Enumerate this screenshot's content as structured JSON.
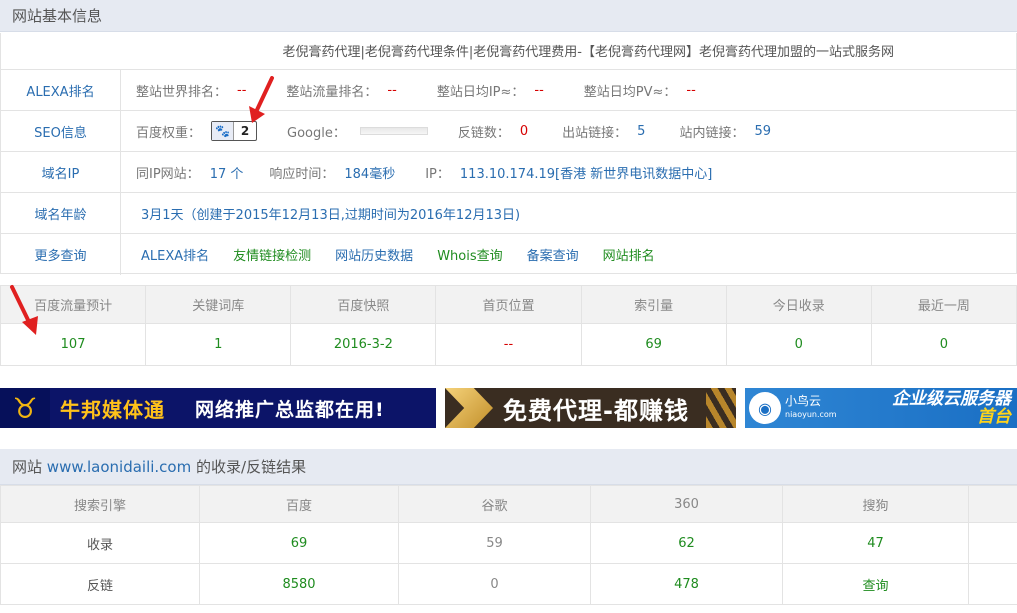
{
  "basic": {
    "header": "网站基本信息",
    "site_title": "老倪膏药代理|老倪膏药代理条件|老倪膏药代理费用-【老倪膏药代理网】老倪膏药代理加盟的一站式服务网",
    "alexa": {
      "label": "ALEXA排名",
      "world_rank_label": "整站世界排名：",
      "world_rank": "--",
      "traffic_rank_label": "整站流量排名：",
      "traffic_rank": "--",
      "daily_ip_label": "整站日均IP≈：",
      "daily_ip": "--",
      "daily_pv_label": "整站日均PV≈：",
      "daily_pv": "--"
    },
    "seo": {
      "label": "SEO信息",
      "baidu_weight_label": "百度权重：",
      "baidu_weight": "2",
      "baidu_icon": "baidu-paw-icon",
      "google_label": "Google：",
      "backlinks_label": "反链数：",
      "backlinks": "0",
      "outlinks_label": "出站链接：",
      "outlinks": "5",
      "inlinks_label": "站内链接：",
      "inlinks": "59"
    },
    "ip": {
      "label": "域名IP",
      "same_ip_label": "同IP网站：",
      "same_ip": "17 个",
      "response_label": "响应时间：",
      "response": "184毫秒",
      "ip_label": "IP：",
      "ip": "113.10.174.19[香港 新世界电讯数据中心]"
    },
    "age": {
      "label": "域名年龄",
      "value": "3月1天（创建于2015年12月13日,过期时间为2016年12月13日)"
    },
    "more": {
      "label": "更多查询",
      "links": [
        "ALEXA排名",
        "友情链接检测",
        "网站历史数据",
        "Whois查询",
        "备案查询",
        "网站排名"
      ]
    }
  },
  "stats": {
    "headers": [
      "百度流量预计",
      "关键词库",
      "百度快照",
      "首页位置",
      "索引量",
      "今日收录",
      "最近一周"
    ],
    "values": [
      "107",
      "1",
      "2016-3-2",
      "--",
      "69",
      "0",
      "0"
    ]
  },
  "banners": {
    "ad1": {
      "logo": "♉",
      "brand": "牛邦媒体通",
      "slogan": "网络推广总监都在用!"
    },
    "ad2": {
      "text": "免费代理-都赚钱"
    },
    "ad3": {
      "name": "小鸟云",
      "domain": "niaoyun.com",
      "tag1": "企业级云服务器",
      "tag2": "首台"
    }
  },
  "results": {
    "header_prefix": "网站",
    "domain": "www.laonidaili.com",
    "header_suffix": "的收录/反链结果",
    "headers": [
      "搜索引擎",
      "百度",
      "谷歌",
      "360",
      "搜狗",
      ""
    ],
    "rows": [
      {
        "label": "收录",
        "values": [
          "69",
          "59",
          "62",
          "47",
          ""
        ]
      },
      {
        "label": "反链",
        "values": [
          "8580",
          "0",
          "478",
          "查询",
          ""
        ]
      }
    ]
  },
  "colors": {
    "accent_blue": "#2a6db0",
    "value_green": "#1f8c1f",
    "value_red": "#d60000",
    "header_bg": "#e6eaf2",
    "arrow_red": "#e02020"
  }
}
